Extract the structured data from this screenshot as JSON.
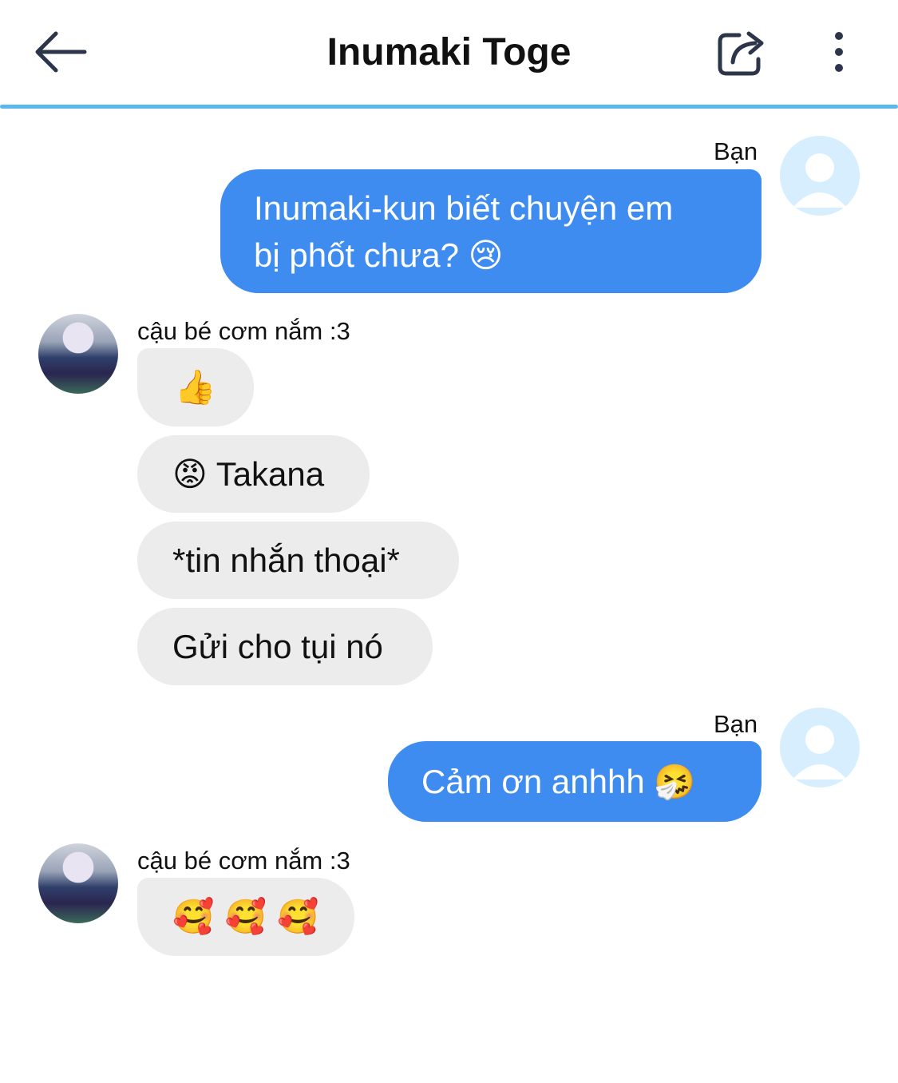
{
  "header": {
    "title": "Inumaki Toge",
    "back_icon": "arrow-left-icon",
    "share_icon": "share-icon",
    "more_icon": "more-vertical-icon",
    "accent_color": "#5bb8ec"
  },
  "colors": {
    "outgoing_bubble": "#3e8cf0",
    "incoming_bubble": "#ececec",
    "my_avatar_bg": "#d6eefd"
  },
  "messages": [
    {
      "sender": "Bạn",
      "direction": "outgoing",
      "lines": [
        "Inumaki-kun biết chuyện em",
        "bị phốt chưa? 😢"
      ]
    },
    {
      "sender": "cậu bé cơm nắm :3",
      "direction": "incoming",
      "bubbles": [
        "👍",
        "😡 Takana",
        "*tin nhắn thoại*",
        "Gửi cho tụi nó"
      ]
    },
    {
      "sender": "Bạn",
      "direction": "outgoing",
      "text": "Cảm ơn anhhh 🤧"
    },
    {
      "sender": "cậu bé cơm nắm :3",
      "direction": "incoming",
      "bubbles": [
        "🥰 🥰 🥰"
      ]
    }
  ]
}
